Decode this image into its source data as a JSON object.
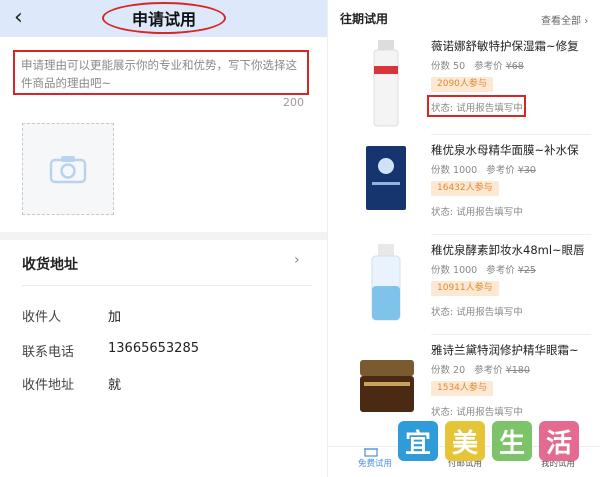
{
  "apply": {
    "back_icon": "back-arrow",
    "title": "申请试用",
    "reason_placeholder": "申请理由可以更能展示你的专业和优势，写下你选择这件商品的理由吧~",
    "char_limit": "200",
    "upload_icon": "camera-icon"
  },
  "address": {
    "heading": "收货地址",
    "arrow": "›",
    "fields": [
      {
        "label": "收件人",
        "value": "加"
      },
      {
        "label": "联系电话",
        "value": "13665653285"
      },
      {
        "label": "收件地址",
        "value": "就"
      }
    ]
  },
  "past": {
    "title": "往期试用",
    "view_all": "查看全部",
    "view_all_arrow": "›",
    "items": [
      {
        "name": "薇诺娜舒敏特护保湿霜~修复",
        "count": "份数 50",
        "ref_label": "参考价",
        "price": "¥68",
        "participants": "2090人参与",
        "status": "状态: 试用报告填写中"
      },
      {
        "name": "稚优泉水母精华面膜~补水保",
        "count": "份数 1000",
        "ref_label": "参考价",
        "price": "¥30",
        "participants": "16432人参与",
        "status": "状态: 试用报告填写中"
      },
      {
        "name": "稚优泉酵素卸妆水48ml~眼唇",
        "count": "份数 1000",
        "ref_label": "参考价",
        "price": "¥25",
        "participants": "10911人参与",
        "status": "状态: 试用报告填写中"
      },
      {
        "name": "雅诗兰黛特润修护精华眼霜~",
        "count": "份数 20",
        "ref_label": "参考价",
        "price": "¥180",
        "participants": "1534人参与",
        "status": "状态: 试用报告填写中"
      }
    ]
  },
  "tabs": [
    {
      "label": "免费试用",
      "icon": "gift-icon"
    },
    {
      "label": "付邮试用"
    },
    {
      "label": "我的试用"
    }
  ],
  "watermark": [
    "宜",
    "美",
    "生",
    "活"
  ],
  "colors": {
    "highlight": "#d62626",
    "accent": "#4b90e3",
    "badge_bg": "#fde8d3",
    "badge_text": "#e08a30",
    "topbar": "#dde9fb"
  }
}
